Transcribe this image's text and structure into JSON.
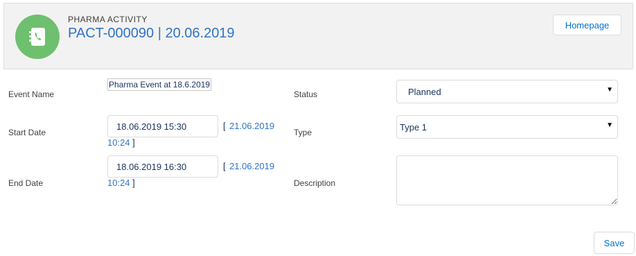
{
  "header": {
    "icon": "contact-phonebook-icon",
    "icon_color": "#6ec06e",
    "entity_label": "PHARMA ACTIVITY",
    "record_title": "PACT-000090 | 20.06.2019",
    "homepage_button": "Homepage"
  },
  "form": {
    "event_name": {
      "label": "Event Name",
      "value": "Pharma Event at 18.6.2019"
    },
    "start_date": {
      "label": "Start Date",
      "value": "18.06.2019 15:30",
      "now_open": "[",
      "now_link_line1": "21.06.2019",
      "now_link_line2": "10:24",
      "now_close": "]"
    },
    "end_date": {
      "label": "End Date",
      "value": "18.06.2019 16:30",
      "now_open": "[",
      "now_link_line1": "21.06.2019",
      "now_link_line2": "10:24",
      "now_close": "]"
    },
    "status": {
      "label": "Status",
      "value": "Planned"
    },
    "type": {
      "label": "Type",
      "value": "Type 1"
    },
    "description": {
      "label": "Description",
      "value": ""
    }
  },
  "actions": {
    "save_label": "Save"
  },
  "colors": {
    "link": "#2e74c8",
    "button_text": "#0070d2",
    "header_bg": "#f3f2f2"
  }
}
